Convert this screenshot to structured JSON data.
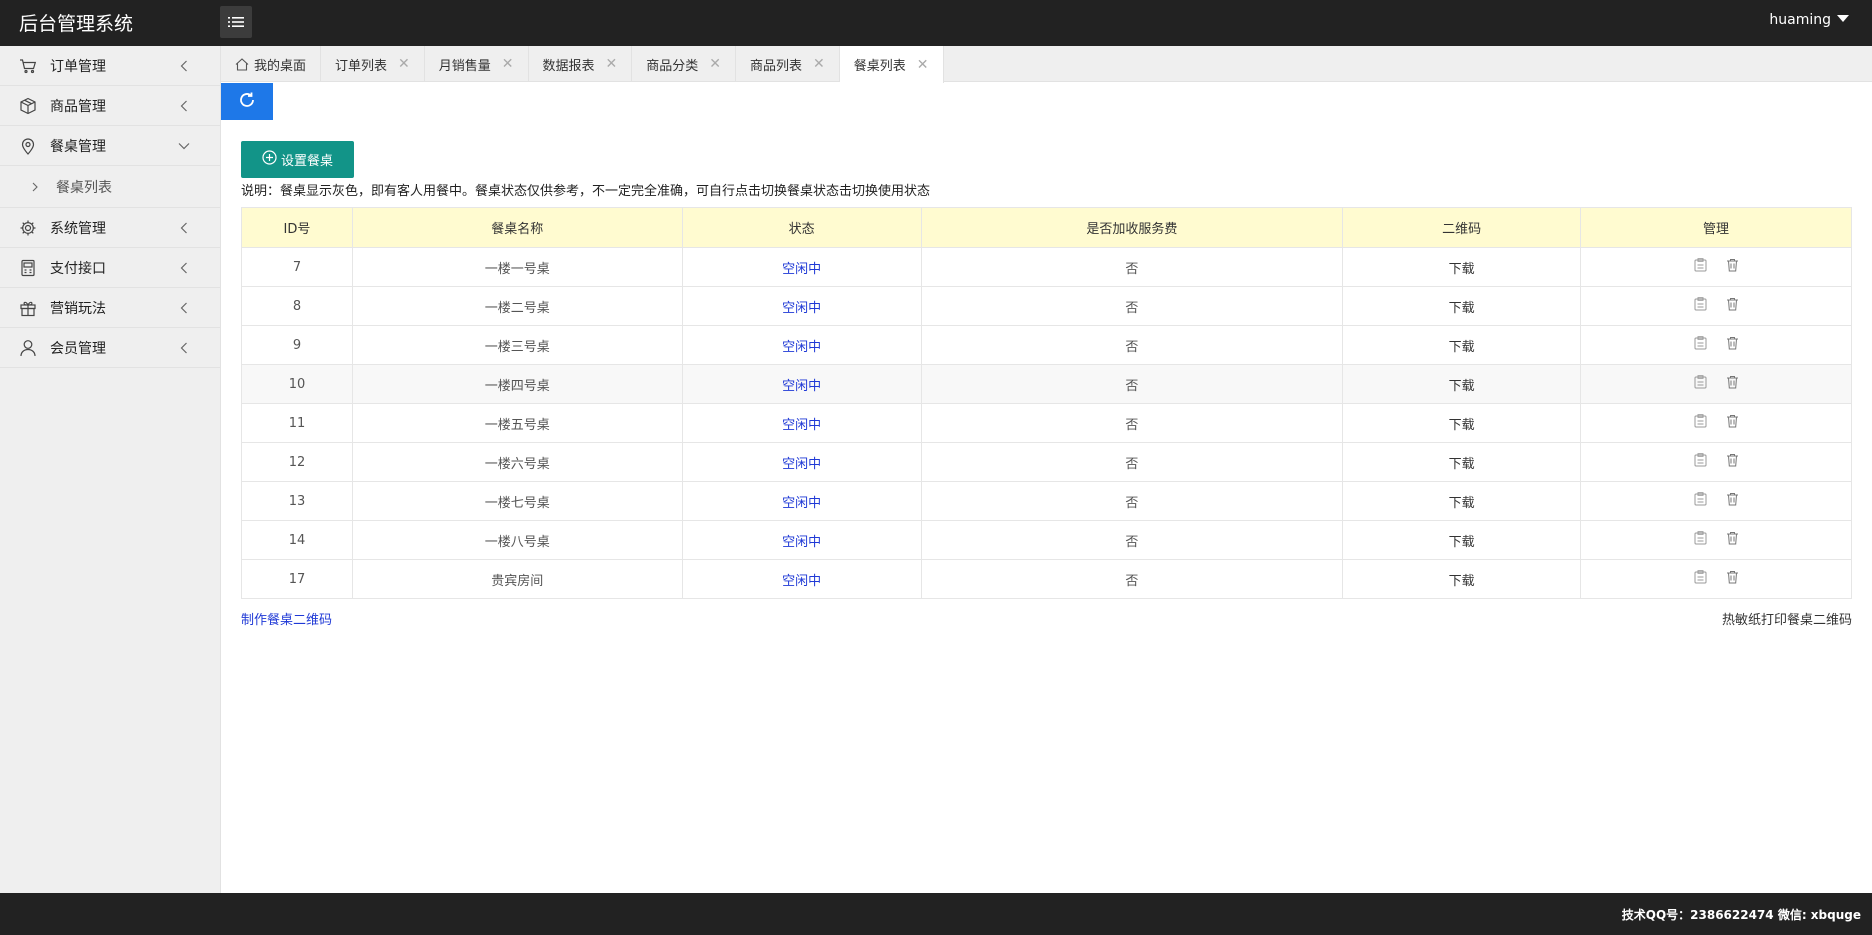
{
  "header": {
    "title": "后台管理系统",
    "user": "huaming"
  },
  "sidebar": {
    "items": [
      {
        "label": "订单管理",
        "icon": "cart-icon"
      },
      {
        "label": "商品管理",
        "icon": "box-icon"
      },
      {
        "label": "餐桌管理",
        "icon": "location-icon",
        "expanded": true
      },
      {
        "label": "系统管理",
        "icon": "gear-icon"
      },
      {
        "label": "支付接口",
        "icon": "pos-icon"
      },
      {
        "label": "营销玩法",
        "icon": "gift-icon"
      },
      {
        "label": "会员管理",
        "icon": "user-icon"
      }
    ],
    "sub_items": [
      {
        "label": "餐桌列表"
      }
    ]
  },
  "tabs": [
    {
      "label": "我的桌面",
      "closable": false
    },
    {
      "label": "订单列表",
      "closable": true
    },
    {
      "label": "月销售量",
      "closable": true
    },
    {
      "label": "数据报表",
      "closable": true
    },
    {
      "label": "商品分类",
      "closable": true
    },
    {
      "label": "商品列表",
      "closable": true
    },
    {
      "label": "餐桌列表",
      "closable": true,
      "active": true
    }
  ],
  "content": {
    "set_button": "设置餐桌",
    "note": "说明：餐桌显示灰色，即有客人用餐中。餐桌状态仅供参考，不一定完全准确，可自行点击切换餐桌状态击切换使用状态",
    "make_qr_link": "制作餐桌二维码",
    "thermal_print_link": "热敏纸打印餐桌二维码"
  },
  "table": {
    "headers": [
      "ID号",
      "餐桌名称",
      "状态",
      "是否加收服务费",
      "二维码",
      "管理"
    ],
    "rows": [
      {
        "id": "7",
        "name": "一楼一号桌",
        "status": "空闲中",
        "fee": "否",
        "qr": "下载"
      },
      {
        "id": "8",
        "name": "一楼二号桌",
        "status": "空闲中",
        "fee": "否",
        "qr": "下载"
      },
      {
        "id": "9",
        "name": "一楼三号桌",
        "status": "空闲中",
        "fee": "否",
        "qr": "下载"
      },
      {
        "id": "10",
        "name": "一楼四号桌",
        "status": "空闲中",
        "fee": "否",
        "qr": "下载"
      },
      {
        "id": "11",
        "name": "一楼五号桌",
        "status": "空闲中",
        "fee": "否",
        "qr": "下载"
      },
      {
        "id": "12",
        "name": "一楼六号桌",
        "status": "空闲中",
        "fee": "否",
        "qr": "下载"
      },
      {
        "id": "13",
        "name": "一楼七号桌",
        "status": "空闲中",
        "fee": "否",
        "qr": "下载"
      },
      {
        "id": "14",
        "name": "一楼八号桌",
        "status": "空闲中",
        "fee": "否",
        "qr": "下载"
      },
      {
        "id": "17",
        "name": "贵宾房间",
        "status": "空闲中",
        "fee": "否",
        "qr": "下载"
      }
    ]
  },
  "footer": {
    "text": "技术QQ号：2386622474 微信: xbquge"
  },
  "colors": {
    "header_bg": "#222222",
    "refresh_bg": "#1e78e8",
    "set_button_bg": "#129488",
    "table_header_bg": "#fffbd0",
    "link": "#1f39d6"
  }
}
